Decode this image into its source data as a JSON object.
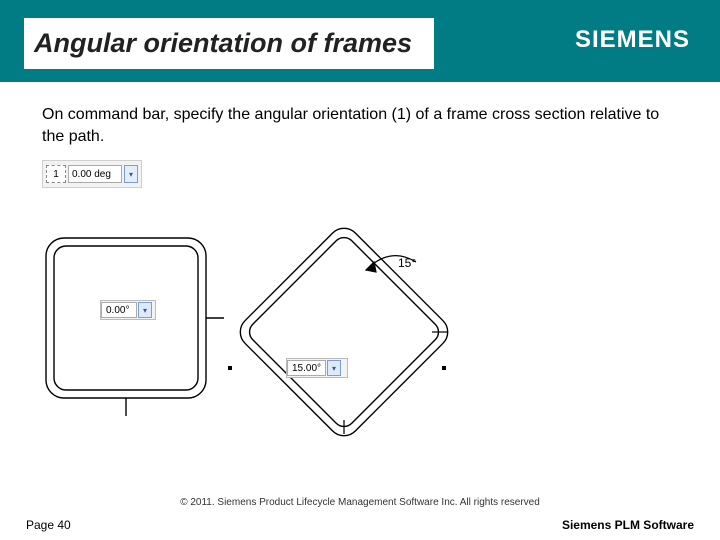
{
  "header": {
    "title": "Angular orientation of frames",
    "logo": "SIEMENS"
  },
  "body": {
    "paragraph": "On command bar, specify the angular orientation (1) of a frame cross section relative to the path."
  },
  "cmdbar": {
    "marker": "1",
    "value": "0.00 deg"
  },
  "fig": {
    "dd1_value": "0.00°",
    "dd2_value": "15.00°",
    "rotation_label": "15°"
  },
  "footer": {
    "copyright": "© 2011. Siemens Product Lifecycle Management Software Inc. All rights reserved",
    "page": "Page 40",
    "brand": "Siemens PLM Software"
  }
}
